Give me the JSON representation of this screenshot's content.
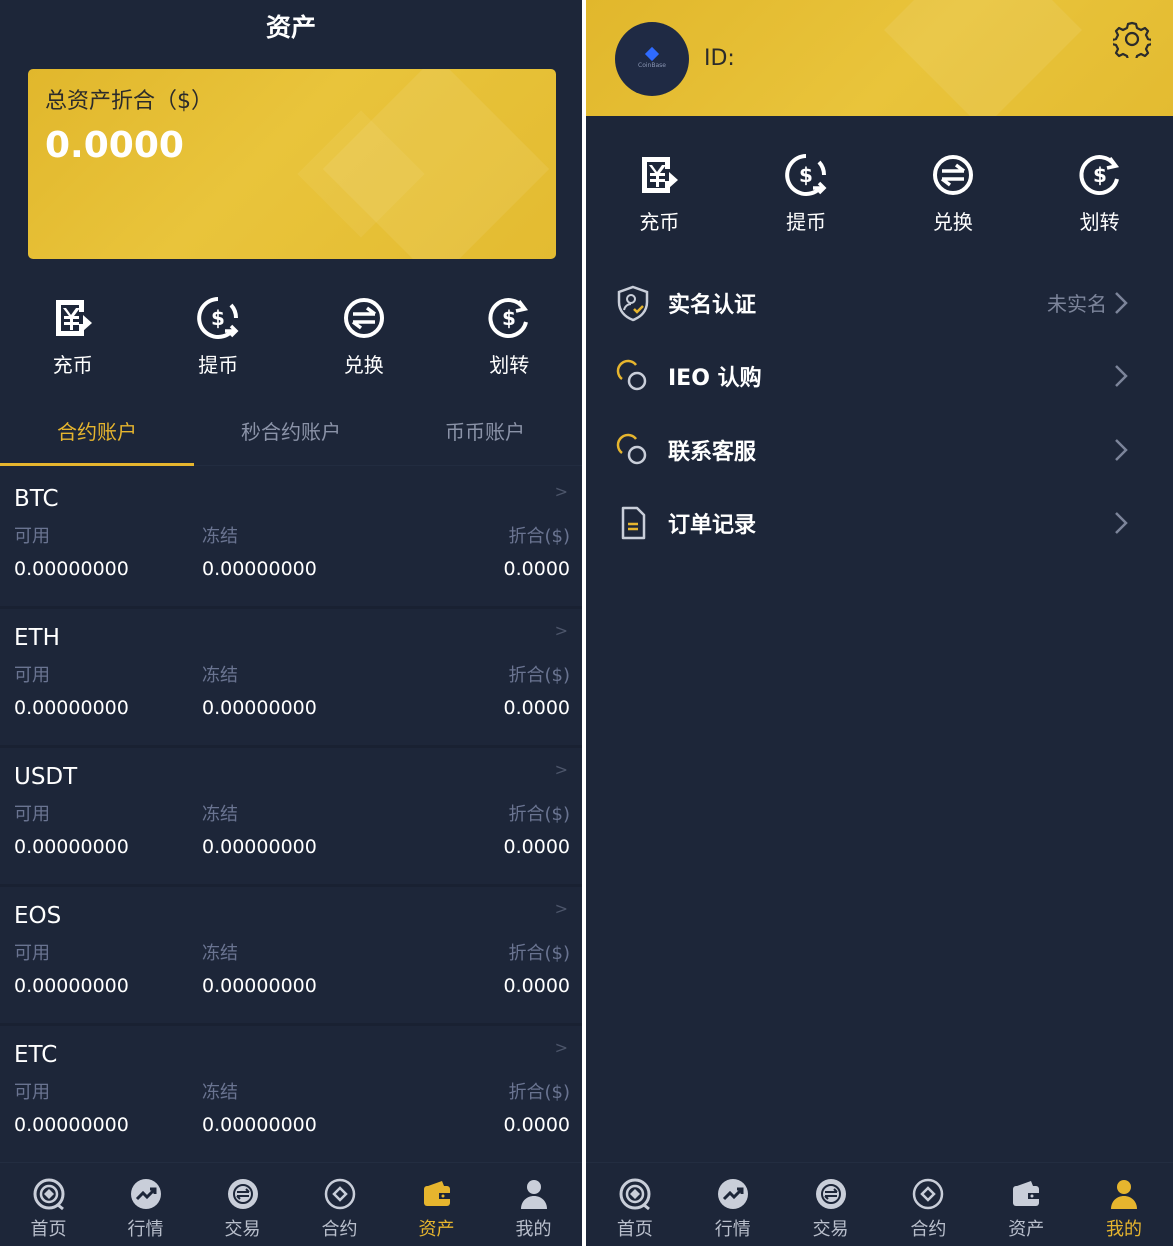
{
  "left": {
    "title": "资产",
    "asset_card": {
      "label": "总资产折合（$）",
      "value": "0.0000"
    },
    "actions": [
      {
        "label": "充币",
        "icon": "deposit-icon"
      },
      {
        "label": "提币",
        "icon": "withdraw-icon"
      },
      {
        "label": "兑换",
        "icon": "exchange-icon"
      },
      {
        "label": "划转",
        "icon": "transfer-icon"
      }
    ],
    "tabs": [
      {
        "label": "合约账户",
        "active": true
      },
      {
        "label": "秒合约账户",
        "active": false
      },
      {
        "label": "币币账户",
        "active": false
      }
    ],
    "column_labels": {
      "available": "可用",
      "frozen": "冻结",
      "equivalent": "折合($)"
    },
    "coins": [
      {
        "name": "BTC",
        "available": "0.00000000",
        "frozen": "0.00000000",
        "equivalent": "0.0000"
      },
      {
        "name": "ETH",
        "available": "0.00000000",
        "frozen": "0.00000000",
        "equivalent": "0.0000"
      },
      {
        "name": "USDT",
        "available": "0.00000000",
        "frozen": "0.00000000",
        "equivalent": "0.0000"
      },
      {
        "name": "EOS",
        "available": "0.00000000",
        "frozen": "0.00000000",
        "equivalent": "0.0000"
      },
      {
        "name": "ETC",
        "available": "0.00000000",
        "frozen": "0.00000000",
        "equivalent": "0.0000"
      }
    ],
    "arrow": ">"
  },
  "tabbar": [
    {
      "label": "首页",
      "icon": "home-icon"
    },
    {
      "label": "行情",
      "icon": "market-icon"
    },
    {
      "label": "交易",
      "icon": "trade-icon"
    },
    {
      "label": "合约",
      "icon": "contract-icon"
    },
    {
      "label": "资产",
      "icon": "wallet-icon"
    },
    {
      "label": "我的",
      "icon": "user-icon"
    }
  ],
  "right": {
    "avatar_text": "CoinBase",
    "uid_label": "ID:",
    "actions": [
      {
        "label": "充币",
        "icon": "deposit-icon"
      },
      {
        "label": "提币",
        "icon": "withdraw-icon"
      },
      {
        "label": "兑换",
        "icon": "exchange-icon"
      },
      {
        "label": "划转",
        "icon": "transfer-icon"
      }
    ],
    "menu": [
      {
        "label": "实名认证",
        "status": "未实名",
        "icon": "id-shield-icon"
      },
      {
        "label": "IEO 认购",
        "status": "",
        "icon": "ieo-circles-icon"
      },
      {
        "label": "联系客服",
        "status": "",
        "icon": "service-circles-icon"
      },
      {
        "label": "订单记录",
        "status": "",
        "icon": "document-icon"
      }
    ]
  },
  "colors": {
    "background": "#1d2639",
    "accent": "#e6b52e",
    "card": "#e5bd33",
    "muted": "#6a7491"
  }
}
